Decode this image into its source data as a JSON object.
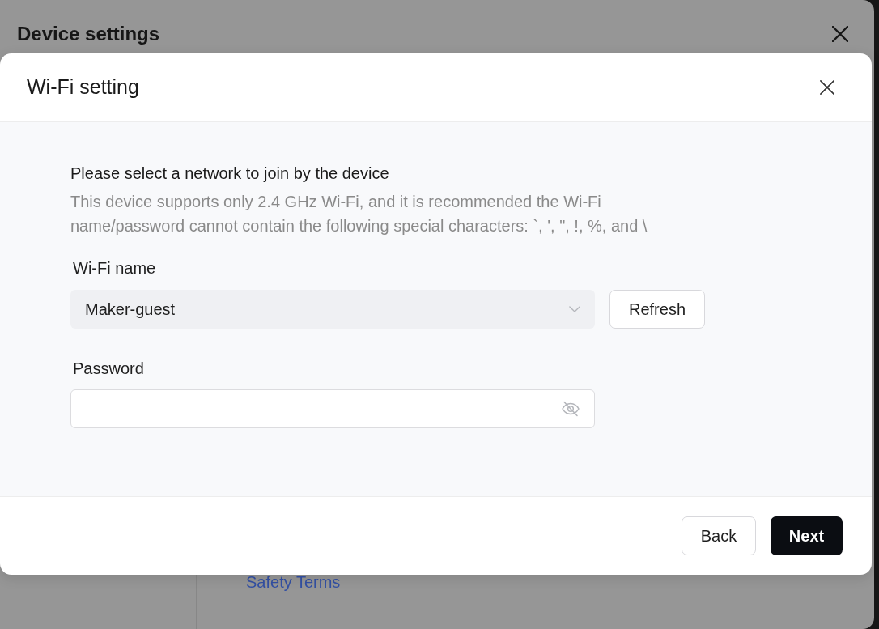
{
  "window": {
    "title": "Device settings",
    "link": "Safety Terms"
  },
  "dialog": {
    "title": "Wi-Fi setting",
    "heading": "Please select a network to join by the device",
    "description": "This device supports only 2.4 GHz Wi-Fi, and it is recommended the Wi-Fi name/password cannot contain the following special characters: `, ', \", !, %, and \\",
    "fields": [
      {
        "kind": "select",
        "label": "Wi-Fi name",
        "value": "Maker-guest",
        "button": "Refresh"
      },
      {
        "kind": "password",
        "label": "Password"
      }
    ],
    "buttons": [
      {
        "label": "Back",
        "primary": false
      },
      {
        "label": "Next",
        "primary": true
      }
    ]
  }
}
